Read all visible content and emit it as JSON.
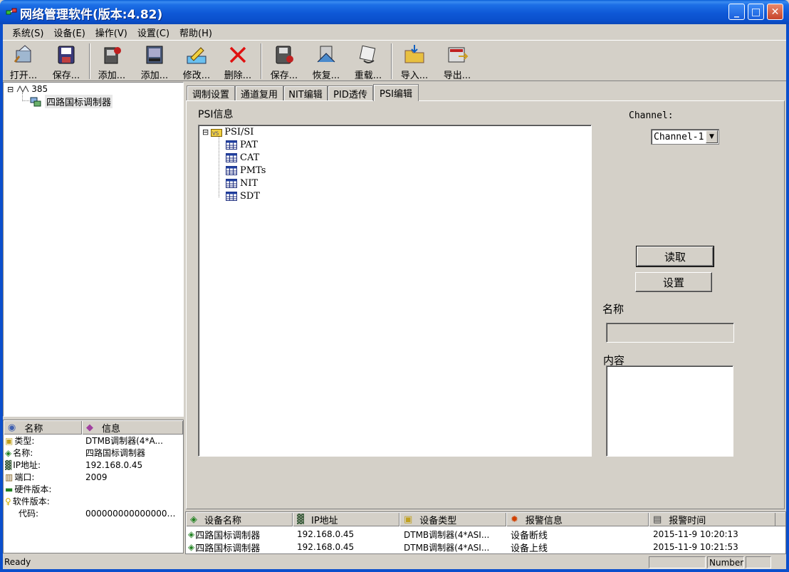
{
  "window": {
    "title": "网络管理软件(版本:4.82)",
    "minimize": "_",
    "maximize": "□",
    "close": "✕"
  },
  "menu": [
    "系统(S)",
    "设备(E)",
    "操作(V)",
    "设置(C)",
    "帮助(H)"
  ],
  "toolbar": {
    "open": "打开...",
    "save": "保存...",
    "add1": "添加...",
    "add2": "添加...",
    "modify": "修改...",
    "delete": "删除...",
    "save2": "保存...",
    "restore": "恢复...",
    "reload": "重载...",
    "import": "导入...",
    "export": "导出..."
  },
  "tree": {
    "expander": "⊟",
    "root": "385",
    "child": "四路国标调制器"
  },
  "info": {
    "headers": [
      "名称",
      "信息"
    ],
    "rows": [
      {
        "key": "类型:",
        "value": "DTMB调制器(4*A..."
      },
      {
        "key": "名称:",
        "value": "四路国标调制器"
      },
      {
        "key": "IP地址:",
        "value": "192.168.0.45"
      },
      {
        "key": "端口:",
        "value": "2009"
      },
      {
        "key": "硬件版本:",
        "value": ""
      },
      {
        "key": "软件版本:",
        "value": ""
      },
      {
        "key": "代码:",
        "value": "0000000000000000..."
      }
    ]
  },
  "tabs": [
    "调制设置",
    "通道复用",
    "NIT编辑",
    "PID透传",
    "PSI编辑"
  ],
  "active_tab": 4,
  "psi": {
    "label": "PSI信息",
    "expander": "⊟",
    "root": "PSI/SI",
    "children": [
      "PAT",
      "CAT",
      "PMTs",
      "NIT",
      "SDT"
    ],
    "channel_label": "Channel:",
    "channel_value": "Channel-1",
    "read_button": "读取",
    "set_button": "设置",
    "name_label": "名称",
    "content_label": "内容"
  },
  "alarms": {
    "headers": [
      "设备名称",
      "IP地址",
      "设备类型",
      "报警信息",
      "报警时间"
    ],
    "rows": [
      {
        "name": "四路国标调制器",
        "ip": "192.168.0.45",
        "type": "DTMB调制器(4*ASI...",
        "alarm": "设备断线",
        "time": "2015-11-9 10:20:13"
      },
      {
        "name": "四路国标调制器",
        "ip": "192.168.0.45",
        "type": "DTMB调制器(4*ASI...",
        "alarm": "设备上线",
        "time": "2015-11-9 10:21:53"
      }
    ]
  },
  "status": {
    "text": "Ready",
    "number": "Number"
  },
  "colors": {
    "titlebar": "#0a4fcc",
    "face": "#d4d0c8",
    "close": "#c7442a"
  }
}
